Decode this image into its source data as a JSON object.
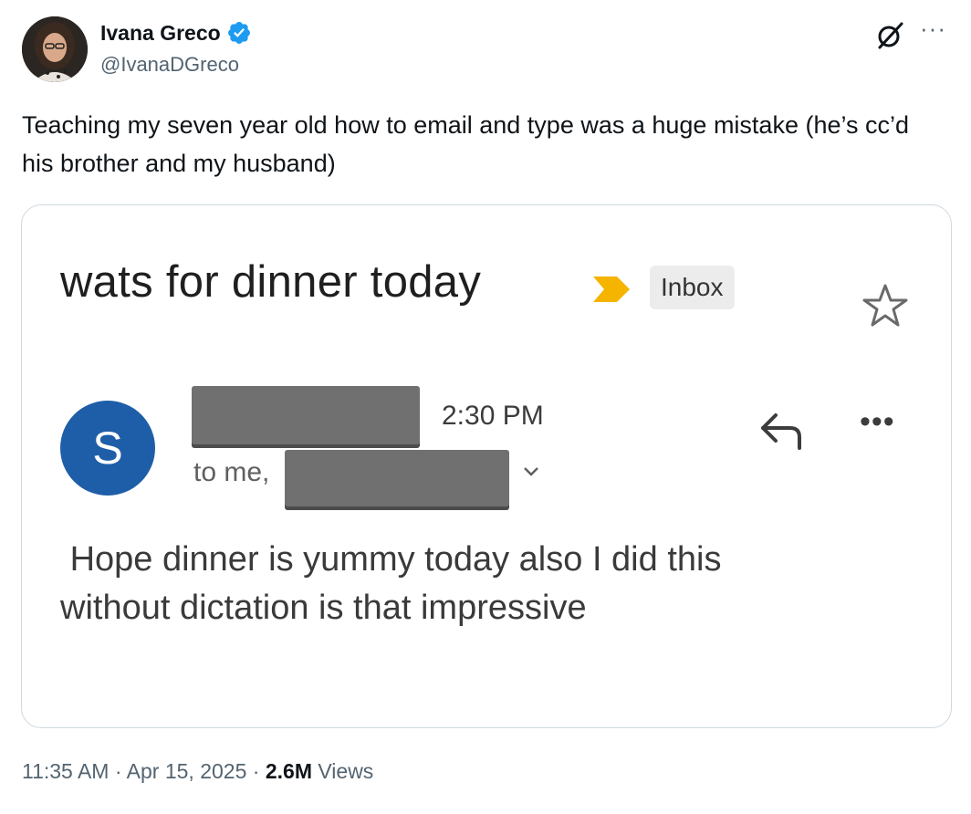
{
  "author": {
    "name": "Ivana Greco",
    "handle": "@IvanaDGreco"
  },
  "tweet": {
    "text": "Teaching my seven year old how to email and type was a huge mistake (he’s cc’d his brother and my husband)"
  },
  "email": {
    "subject": "wats for dinner today",
    "label": "Inbox",
    "sender_initial": "S",
    "time": "2:30 PM",
    "to_prefix": "to me,",
    "body": " Hope dinner is yummy today also I did this\nwithout dictation is that impressive"
  },
  "meta": {
    "time": "11:35 AM",
    "separator": "·",
    "date": "Apr 15, 2025",
    "views_count": "2.6M",
    "views_label": "Views"
  },
  "icons": [
    "verified-badge-icon",
    "grok-icon",
    "more-icon",
    "importance-icon",
    "star-icon",
    "reply-icon",
    "chevron-down-icon"
  ],
  "colors": {
    "verified": "#1d9bf0",
    "importance": "#f4b400",
    "sender_avatar": "#1e5ea8",
    "redaction": "#707070"
  }
}
